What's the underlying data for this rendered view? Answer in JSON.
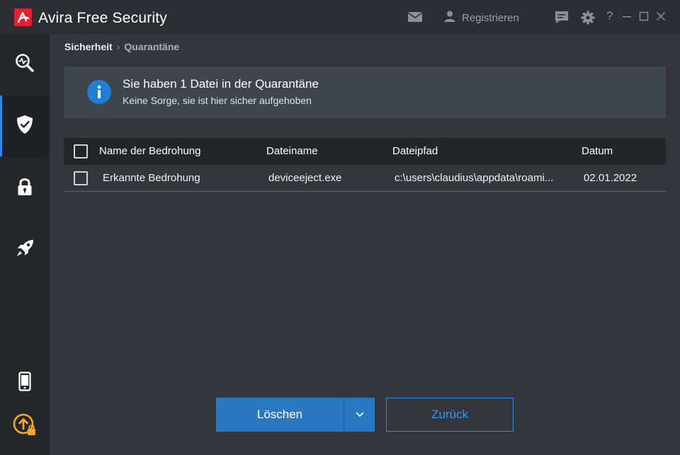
{
  "app": {
    "brand_main": "Avira",
    "brand_sub": "Free Security"
  },
  "header": {
    "register_label": "Registrieren",
    "help_label": "?"
  },
  "breadcrumb": {
    "parent": "Sicherheit",
    "separator": "›",
    "current": "Quarantäne"
  },
  "info": {
    "title": "Sie haben 1 Datei in der Quarantäne",
    "subtitle": "Keine Sorge, sie ist hier sicher aufgehoben"
  },
  "table": {
    "columns": [
      "Name der Bedrohung",
      "Dateiname",
      "Dateipfad",
      "Datum"
    ],
    "rows": [
      {
        "threat": "Erkannte Bedrohung",
        "filename": "deviceeject.exe",
        "path": "c:\\users\\claudius\\appdata\\roami...",
        "date": "02.01.2022"
      }
    ]
  },
  "actions": {
    "delete_label": "Löschen",
    "back_label": "Zurück"
  },
  "sidebar": {
    "items": [
      {
        "icon": "scan-icon",
        "active": false
      },
      {
        "icon": "shield-check-icon",
        "active": true
      },
      {
        "icon": "lock-icon",
        "active": false
      },
      {
        "icon": "rocket-icon",
        "active": false
      },
      {
        "icon": "mobile-icon",
        "active": false
      },
      {
        "icon": "upgrade-icon",
        "active": false
      }
    ]
  },
  "colors": {
    "accent": "#2b78c2",
    "brand_red": "#e3202b",
    "upgrade_orange": "#f5a623"
  }
}
